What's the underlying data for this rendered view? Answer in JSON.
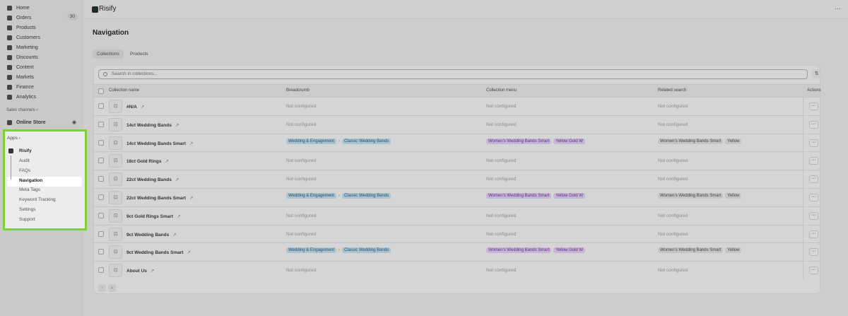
{
  "sidebar": {
    "items": [
      {
        "label": "Home"
      },
      {
        "label": "Orders",
        "badge": "30"
      },
      {
        "label": "Products"
      },
      {
        "label": "Customers"
      },
      {
        "label": "Marketing"
      },
      {
        "label": "Discounts"
      },
      {
        "label": "Content"
      },
      {
        "label": "Markets"
      },
      {
        "label": "Finance"
      },
      {
        "label": "Analytics"
      }
    ],
    "sales_channels": "Sales channels ›",
    "online_store": "Online Store",
    "apps": "Apps ›",
    "app_name": "Risify",
    "app_items": [
      "Audit",
      "FAQs",
      "Navigation",
      "Meta Tags",
      "Keyword Tracking",
      "Settings",
      "Support"
    ]
  },
  "topbar": {
    "brand": "Risify",
    "more": "···"
  },
  "page": {
    "title": "Navigation",
    "tabs": [
      "Collections",
      "Products"
    ],
    "search_placeholder": "Search in collections..."
  },
  "table": {
    "headers": [
      "Collection name",
      "Breadcrumb",
      "Collection menu",
      "Related search",
      "Actions"
    ],
    "not_configured": "Not configured",
    "rows": [
      {
        "name": "#N/A",
        "bc": null,
        "menu": null,
        "rel": null
      },
      {
        "name": "14ct Wedding Bands",
        "bc": null,
        "menu": null,
        "rel": null
      },
      {
        "name": "14ct Wedding Bands Smart",
        "bc": [
          "Wedding & Engagement",
          "Classic Wedding Bands"
        ],
        "menu": [
          "Women's Wedding Bands Smart",
          "Yellow Gold W"
        ],
        "rel": [
          "Women's Wedding Bands Smart",
          "Yellow"
        ]
      },
      {
        "name": "18ct Gold Rings",
        "bc": null,
        "menu": null,
        "rel": null
      },
      {
        "name": "22ct Wedding Bands",
        "bc": null,
        "menu": null,
        "rel": null
      },
      {
        "name": "22ct Wedding Bands Smart",
        "bc": [
          "Wedding & Engagement",
          "Classic Wedding Bands"
        ],
        "menu": [
          "Women's Wedding Bands Smart",
          "Yellow Gold W"
        ],
        "rel": [
          "Women's Wedding Bands Smart",
          "Yellow"
        ]
      },
      {
        "name": "9ct Gold Rings Smart",
        "bc": null,
        "menu": null,
        "rel": null
      },
      {
        "name": "9ct Wedding Bands",
        "bc": null,
        "menu": null,
        "rel": null
      },
      {
        "name": "9ct Wedding Bands Smart",
        "bc": [
          "Wedding & Engagement",
          "Classic Wedding Bands"
        ],
        "menu": [
          "Women's Wedding Bands Smart",
          "Yellow Gold W"
        ],
        "rel": [
          "Women's Wedding Bands Smart",
          "Yellow"
        ]
      },
      {
        "name": "About Us",
        "bc": null,
        "menu": null,
        "rel": null
      }
    ]
  },
  "pagination": {
    "prev": "‹",
    "next": "›"
  }
}
